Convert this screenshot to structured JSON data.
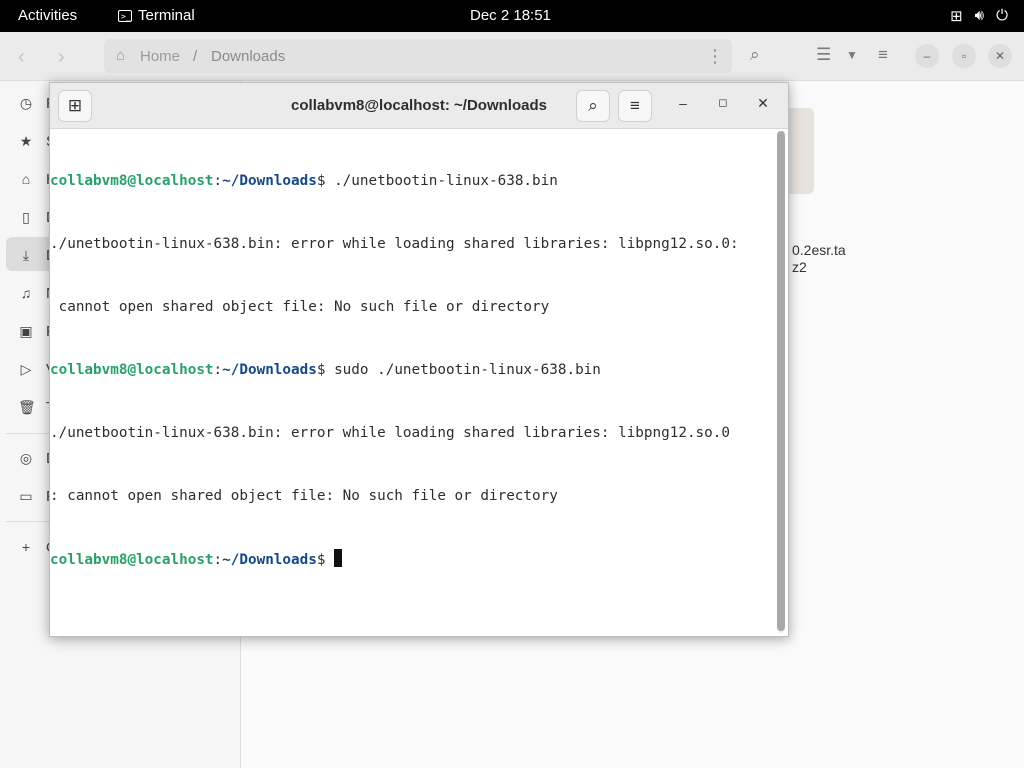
{
  "topbar": {
    "activities": "Activities",
    "app_name": "Terminal",
    "app_icon": "terminal-icon",
    "clock": "Dec 2  18:51",
    "tray_icons": [
      "network-icon",
      "volume-icon",
      "power-icon"
    ]
  },
  "files": {
    "path": {
      "home": "Home",
      "separator": "/",
      "current": "Downloads"
    },
    "sidebar": {
      "items": [
        {
          "icon": "clock-icon",
          "label": "R"
        },
        {
          "icon": "star-icon",
          "label": "S"
        },
        {
          "icon": "home-icon",
          "label": "H"
        },
        {
          "icon": "document-icon",
          "label": "D"
        },
        {
          "icon": "download-icon",
          "label": "D"
        },
        {
          "icon": "music-icon",
          "label": "M"
        },
        {
          "icon": "picture-icon",
          "label": "P"
        },
        {
          "icon": "video-icon",
          "label": "V"
        },
        {
          "icon": "trash-icon",
          "label": "T"
        },
        {
          "icon": "disc-icon",
          "label": "D"
        },
        {
          "icon": "drive-icon",
          "label": "F"
        },
        {
          "icon": "plus-icon",
          "label": "O"
        }
      ]
    },
    "file": {
      "name_line1": "0.2esr.ta",
      "name_line2": "z2"
    }
  },
  "terminal": {
    "title": "collabvm8@localhost: ~/Downloads",
    "lines": [
      {
        "user": "collabvm8@localhost",
        "colon": ":",
        "path": "~/Downloads",
        "prompt": "$ ",
        "text": "./unetbootin-linux-638.bin"
      },
      {
        "text": "./unetbootin-linux-638.bin: error while loading shared libraries: libpng12.so.0:"
      },
      {
        "text": " cannot open shared object file: No such file or directory"
      },
      {
        "user": "collabvm8@localhost",
        "colon": ":",
        "path": "~/Downloads",
        "prompt": "$ ",
        "text": "sudo ./unetbootin-linux-638.bin"
      },
      {
        "text": "./unetbootin-linux-638.bin: error while loading shared libraries: libpng12.so.0"
      },
      {
        "text": ": cannot open shared object file: No such file or directory"
      },
      {
        "user": "collabvm8@localhost",
        "colon": ":",
        "path": "~/Downloads",
        "prompt": "$ ",
        "text": ""
      }
    ]
  }
}
